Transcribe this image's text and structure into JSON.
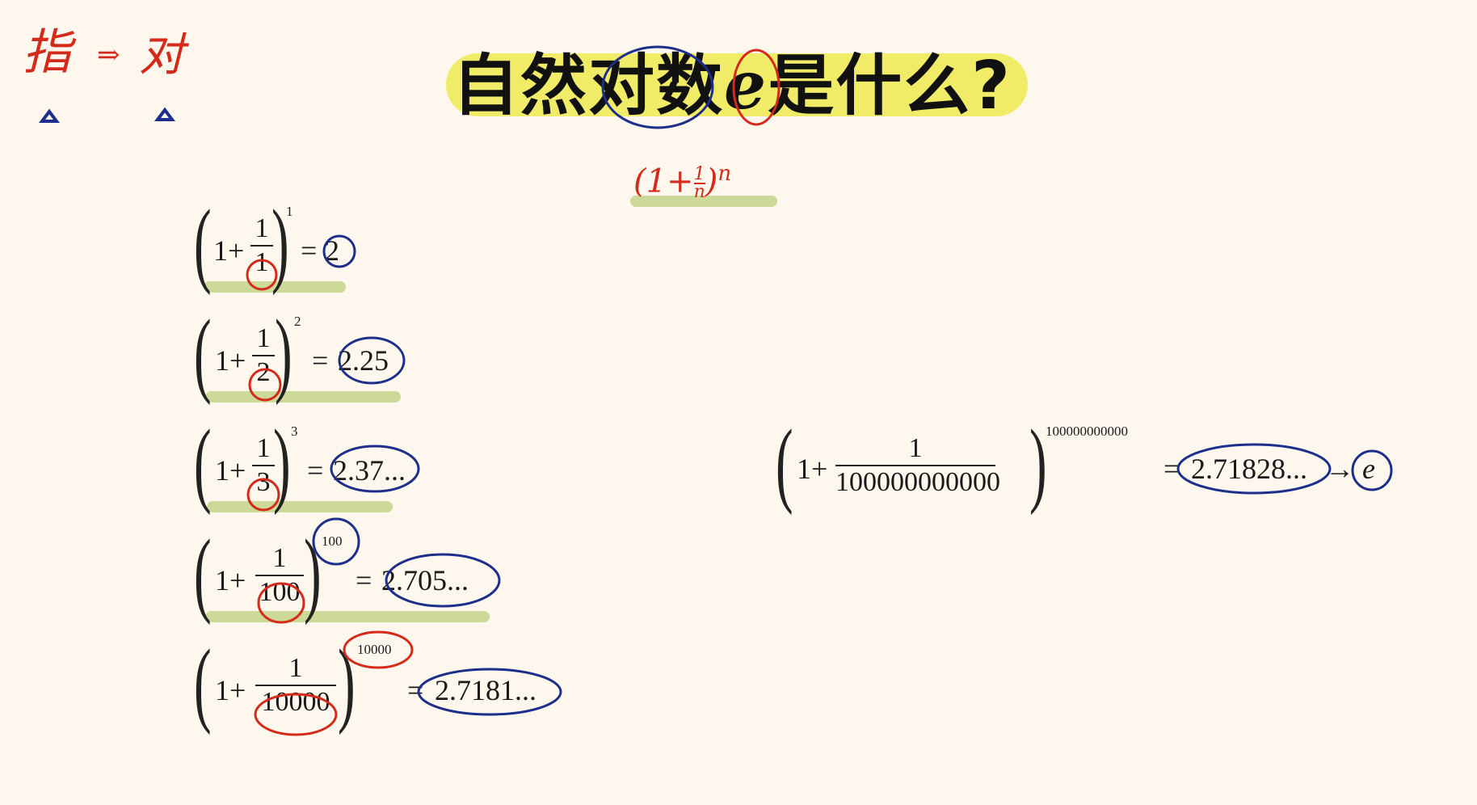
{
  "title": {
    "text_before": "自然对数",
    "e": "e",
    "text_after": "是什么?"
  },
  "handwriting": {
    "top_left_1": "指",
    "arrow": "⇒",
    "top_left_2": "对",
    "subtitle_formula": "(1+",
    "subtitle_n_num": "1",
    "subtitle_n_den": "n",
    "subtitle_close": ")",
    "subtitle_exp": "n"
  },
  "rows": [
    {
      "one_plus": "1+",
      "num": "1",
      "den": "1",
      "exp": "1",
      "eq": "=",
      "result": "2"
    },
    {
      "one_plus": "1+",
      "num": "1",
      "den": "2",
      "exp": "2",
      "eq": "=",
      "result": "2.25"
    },
    {
      "one_plus": "1+",
      "num": "1",
      "den": "3",
      "exp": "3",
      "eq": "=",
      "result": "2.37..."
    },
    {
      "one_plus": "1+",
      "num": "1",
      "den": "100",
      "exp": "100",
      "eq": "=",
      "result": "2.705..."
    },
    {
      "one_plus": "1+",
      "num": "1",
      "den": "10000",
      "exp": "10000",
      "eq": "=",
      "result": "2.7181..."
    }
  ],
  "big": {
    "one_plus": "1+",
    "num": "1",
    "den": "100000000000",
    "exp": "100000000000",
    "eq": "=",
    "result": "2.71828...",
    "arrow": "→",
    "limit": "e"
  },
  "colors": {
    "ink_red": "#d42a1a",
    "ink_blue": "#1d2f8a",
    "highlight_yellow": "#f1ec67",
    "highlight_green": "#c8d58f",
    "background": "#fdf7ee"
  }
}
